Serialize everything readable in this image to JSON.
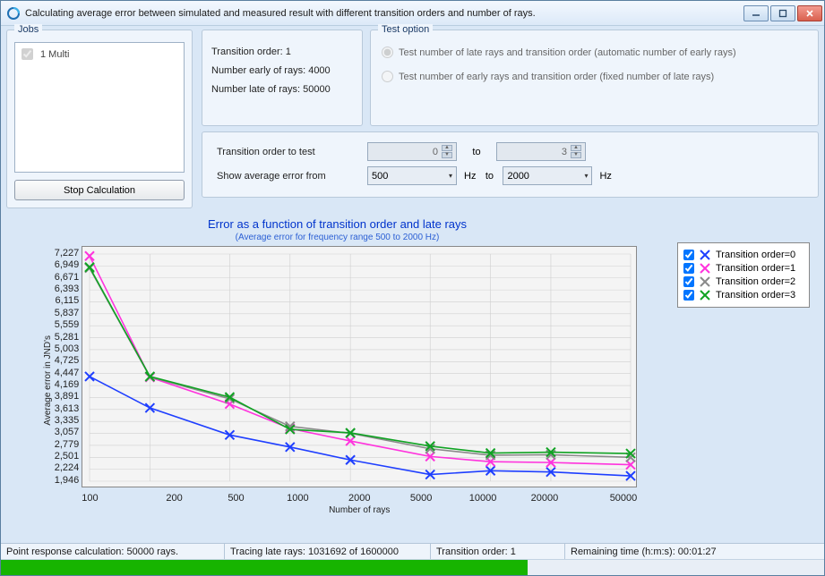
{
  "window": {
    "title": "Calculating average error between simulated and measured result with different transition orders and number of rays."
  },
  "jobs": {
    "group_title": "Jobs",
    "items": [
      {
        "label": "1 Multi",
        "checked": true
      }
    ],
    "stop_button": "Stop Calculation"
  },
  "params": {
    "line1": "Transition order: 1",
    "line2": "Number early of rays: 4000",
    "line3": "Number late of rays: 50000"
  },
  "testopt": {
    "group_title": "Test option",
    "opt1": "Test number of late rays and transition order (automatic number of early rays)",
    "opt2": "Test number of early rays and transition order (fixed number of late rays)",
    "selected": 0
  },
  "controls": {
    "row1_label": "Transition order to test",
    "row1_from": "0",
    "to_label": "to",
    "row1_to": "3",
    "row2_label": "Show average error from",
    "row2_from": "500",
    "hz": "Hz",
    "row2_to": "2000"
  },
  "chart_data": {
    "type": "line",
    "title": "Error as a function of transition order and late rays",
    "subtitle": "(Average error for frequency range 500 to 2000 Hz)",
    "xlabel": "Number of rays",
    "ylabel": "Average error in JND's",
    "x": [
      100,
      200,
      500,
      1000,
      2000,
      5000,
      10000,
      20000,
      50000
    ],
    "yticks": [
      7227,
      6949,
      6671,
      6393,
      6115,
      5837,
      5559,
      5281,
      5003,
      4725,
      4447,
      4169,
      3891,
      3613,
      3335,
      3057,
      2779,
      2501,
      2224,
      1946
    ],
    "ylim": [
      1946,
      7227
    ],
    "xscale": "log",
    "series": [
      {
        "name": "Transition order=0",
        "color": "#1f3fff",
        "values": [
          4380,
          3650,
          3020,
          2740,
          2440,
          2100,
          2190,
          2160,
          2070
        ]
      },
      {
        "name": "Transition order=1",
        "color": "#ff33dd",
        "values": [
          7180,
          4360,
          3740,
          3170,
          2880,
          2520,
          2400,
          2380,
          2330
        ]
      },
      {
        "name": "Transition order=2",
        "color": "#8a8a8a",
        "values": [
          6900,
          4370,
          3860,
          3220,
          3060,
          2700,
          2550,
          2560,
          2500
        ]
      },
      {
        "name": "Transition order=3",
        "color": "#10a323",
        "values": [
          6920,
          4380,
          3900,
          3150,
          3070,
          2760,
          2600,
          2620,
          2590
        ]
      }
    ]
  },
  "status": {
    "cell1": "Point response calculation: 50000 rays.",
    "cell2": "Tracing late rays: 1031692 of 1600000",
    "cell3": "Transition order: 1",
    "cell4": "Remaining time (h:m:s): 00:01:27",
    "progress_pct": 64
  }
}
